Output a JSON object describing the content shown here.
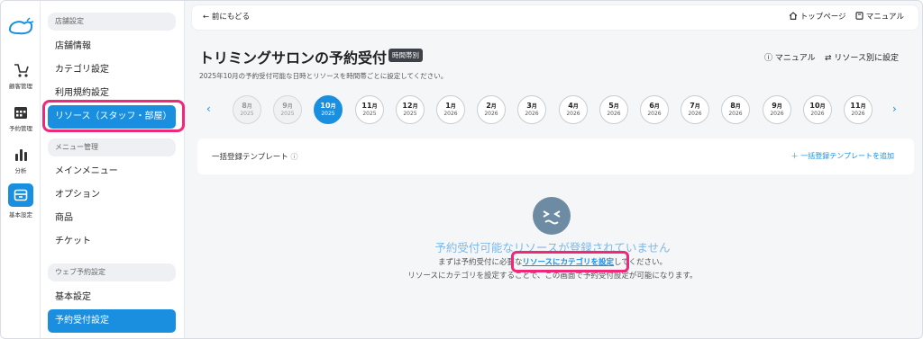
{
  "rail": {
    "items": [
      {
        "label": "顧客管理",
        "icon": "stroller-icon"
      },
      {
        "label": "予約管理",
        "icon": "calendar-icon"
      },
      {
        "label": "分析",
        "icon": "bar-chart-icon"
      },
      {
        "label": "基本設定",
        "icon": "settings-box-icon"
      }
    ]
  },
  "sidebar": {
    "section1": "店舗設定",
    "items1": [
      "店舗情報",
      "カテゴリ設定",
      "利用規約設定",
      "リソース（スタッフ・部屋）"
    ],
    "section2": "メニュー管理",
    "items2": [
      "メインメニュー",
      "オプション",
      "商品",
      "チケット"
    ],
    "section3": "ウェブ予約設定",
    "items3": [
      "基本設定",
      "予約受付設定"
    ]
  },
  "topbar": {
    "back": "前にもどる",
    "top_page": "トップページ",
    "manual": "マニュアル"
  },
  "page": {
    "title": "トリミングサロンの予約受付",
    "badge": "時間帯別",
    "description": "2025年10月の予約受付可能な日時とリソースを時間帯ごとに設定してください。",
    "manual_link": "マニュアル",
    "per_resource": "リソース別に設定"
  },
  "months": [
    {
      "m": "8",
      "y": "2025",
      "state": "past"
    },
    {
      "m": "9",
      "y": "2025",
      "state": "past"
    },
    {
      "m": "10",
      "y": "2025",
      "state": "active"
    },
    {
      "m": "11",
      "y": "2025",
      "state": "normal"
    },
    {
      "m": "12",
      "y": "2025",
      "state": "normal"
    },
    {
      "m": "1",
      "y": "2026",
      "state": "normal"
    },
    {
      "m": "2",
      "y": "2026",
      "state": "normal"
    },
    {
      "m": "3",
      "y": "2026",
      "state": "normal"
    },
    {
      "m": "4",
      "y": "2026",
      "state": "normal"
    },
    {
      "m": "5",
      "y": "2026",
      "state": "normal"
    },
    {
      "m": "6",
      "y": "2026",
      "state": "normal"
    },
    {
      "m": "7",
      "y": "2026",
      "state": "normal"
    },
    {
      "m": "8",
      "y": "2026",
      "state": "normal"
    },
    {
      "m": "9",
      "y": "2026",
      "state": "normal"
    },
    {
      "m": "10",
      "y": "2026",
      "state": "normal"
    },
    {
      "m": "11",
      "y": "2026",
      "state": "normal"
    }
  ],
  "month_suffix": "月",
  "template_card": {
    "title": "一括登録テンプレート",
    "add": "＋ 一括登録テンプレートを追加"
  },
  "empty": {
    "title": "予約受付可能なリソースが登録されていません",
    "line1_before": "まずは予約受付に必要な",
    "line1_link": "リソースにカテゴリを設定",
    "line1_after": "してください。",
    "line2": "リソースにカテゴリを設定することで、この画面で予約受付設定が可能になります。"
  },
  "colors": {
    "accent": "#1a8fe0",
    "highlight": "#f0287a"
  }
}
